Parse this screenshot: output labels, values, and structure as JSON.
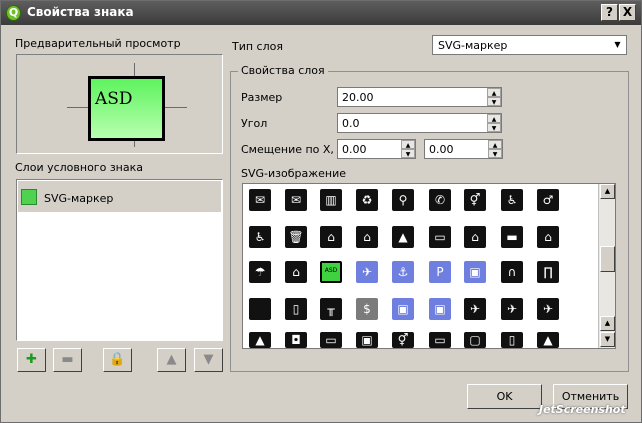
{
  "window": {
    "title": "Свойства знака",
    "help_label": "?",
    "close_label": "X"
  },
  "preview": {
    "heading": "Предварительный просмотр",
    "sample_text": "ASD"
  },
  "layers": {
    "heading": "Слои условного знака",
    "items": [
      {
        "label": "SVG-маркер",
        "selected": true
      }
    ],
    "buttons": [
      {
        "name": "add-layer-button",
        "icon": "plus-icon",
        "glyph": "✚",
        "color": "#1e9a1e"
      },
      {
        "name": "remove-layer-button",
        "icon": "minus-icon",
        "glyph": "▬",
        "color": "#8a8a8a"
      },
      {
        "name": "lock-layer-button",
        "icon": "lock-icon",
        "glyph": "🔒",
        "color": "#d9a514"
      },
      {
        "name": "move-layer-up-button",
        "icon": "triangle-up-icon",
        "glyph": "▲",
        "color": "#8a8a8a"
      },
      {
        "name": "move-layer-down-button",
        "icon": "triangle-down-icon",
        "glyph": "▼",
        "color": "#8a8a8a"
      }
    ]
  },
  "layer_type": {
    "label": "Тип слоя",
    "value": "SVG-маркер"
  },
  "layer_properties": {
    "title": "Свойства слоя",
    "size": {
      "label": "Размер",
      "value": "20.00"
    },
    "angle": {
      "label": "Угол",
      "value": "0.0"
    },
    "offset": {
      "label": "Смещение по X, Y",
      "x": "0.00",
      "y": "0.00"
    },
    "svg_label": "SVG-изображение"
  },
  "svg_icons": [
    [
      {
        "icon": "envelope-icon",
        "glyph": "✉",
        "style": "dark"
      },
      {
        "icon": "mail-circle-icon",
        "glyph": "✉",
        "style": "dark"
      },
      {
        "icon": "lockers-icon",
        "glyph": "▥",
        "style": "dark"
      },
      {
        "icon": "recycle-icon",
        "glyph": "♻",
        "style": "dark"
      },
      {
        "icon": "viewpoint-icon",
        "glyph": "⚲",
        "style": "dark"
      },
      {
        "icon": "telephone-icon",
        "glyph": "✆",
        "style": "dark"
      },
      {
        "icon": "restroom-icon",
        "glyph": "⚥",
        "style": "dark"
      },
      {
        "icon": "accessible-wc-icon",
        "glyph": "♿",
        "style": "dark"
      },
      {
        "icon": "mens-wc-icon",
        "glyph": "♂",
        "style": "dark"
      }
    ],
    [
      {
        "icon": "wc-sign-icon",
        "glyph": "♿",
        "style": "dark"
      },
      {
        "icon": "litter-bin-icon",
        "glyph": "🗑",
        "style": "dark"
      },
      {
        "icon": "shelter-icon",
        "glyph": "⌂",
        "style": "dark"
      },
      {
        "icon": "bed-and-breakfast-icon",
        "glyph": "⌂",
        "style": "dark"
      },
      {
        "icon": "tent-icon",
        "glyph": "▲",
        "style": "dark"
      },
      {
        "icon": "caravan-icon",
        "glyph": "▭",
        "style": "dark"
      },
      {
        "icon": "hut-icon",
        "glyph": "⌂",
        "style": "dark"
      },
      {
        "icon": "hotel-bed-icon",
        "glyph": "▬",
        "style": "dark"
      },
      {
        "icon": "picnic-shelter-icon",
        "glyph": "⌂",
        "style": "dark"
      }
    ],
    [
      {
        "icon": "rain-shelter-icon",
        "glyph": "☂",
        "style": "dark"
      },
      {
        "icon": "forest-house-icon",
        "glyph": "⌂",
        "style": "dark"
      },
      {
        "icon": "asd-marker-icon",
        "glyph": "ASD",
        "style": "asd"
      },
      {
        "icon": "airport-icon",
        "glyph": "✈",
        "style": "blue"
      },
      {
        "icon": "ferry-icon",
        "glyph": "⚓",
        "style": "blue"
      },
      {
        "icon": "parking-icon",
        "glyph": "P",
        "style": "blue"
      },
      {
        "icon": "bus-icon",
        "glyph": "▣",
        "style": "blue"
      },
      {
        "icon": "tombstone-icon",
        "glyph": "∩",
        "style": "dark"
      },
      {
        "icon": "gateway-icon",
        "glyph": "∏",
        "style": "dark"
      }
    ],
    [
      {
        "icon": "blank-dark-icon",
        "glyph": "",
        "style": "dark"
      },
      {
        "icon": "locker-icon",
        "glyph": "▯",
        "style": "dark"
      },
      {
        "icon": "bench-icon",
        "glyph": "╥",
        "style": "dark"
      },
      {
        "icon": "money-icon",
        "glyph": "$",
        "style": "gray"
      },
      {
        "icon": "train-icon",
        "glyph": "▣",
        "style": "blue"
      },
      {
        "icon": "tram-icon",
        "glyph": "▣",
        "style": "blue"
      },
      {
        "icon": "airplane-icon",
        "glyph": "✈",
        "style": "dark"
      },
      {
        "icon": "airplane-alt-icon",
        "glyph": "✈",
        "style": "dark"
      },
      {
        "icon": "airfield-icon",
        "glyph": "✈",
        "style": "dark"
      }
    ],
    [
      {
        "icon": "partial-1-icon",
        "glyph": "▲",
        "style": "dark"
      },
      {
        "icon": "partial-2-icon",
        "glyph": "◘",
        "style": "dark"
      },
      {
        "icon": "partial-3-icon",
        "glyph": "▭",
        "style": "dark"
      },
      {
        "icon": "partial-4-icon",
        "glyph": "▣",
        "style": "dark"
      },
      {
        "icon": "partial-5-icon",
        "glyph": "⚥",
        "style": "dark"
      },
      {
        "icon": "partial-6-icon",
        "glyph": "▭",
        "style": "dark"
      },
      {
        "icon": "partial-7-icon",
        "glyph": "▢",
        "style": "dark"
      },
      {
        "icon": "partial-8-icon",
        "glyph": "▯",
        "style": "dark"
      },
      {
        "icon": "partial-9-icon",
        "glyph": "▲",
        "style": "dark"
      }
    ]
  ],
  "buttons": {
    "ok": "OK",
    "cancel": "Отменить"
  },
  "watermark": "JetScreenshot"
}
